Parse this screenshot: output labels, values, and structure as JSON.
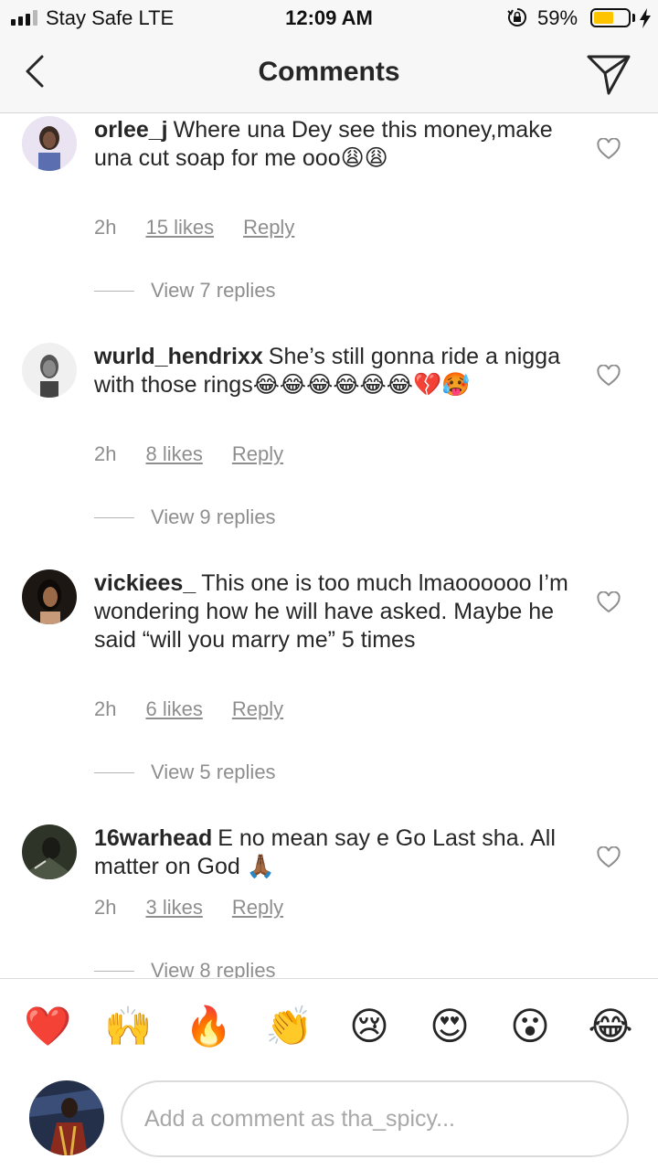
{
  "status_bar": {
    "carrier": "Stay Safe  LTE",
    "time": "12:09 AM",
    "battery": "59%",
    "battery_level": 0.59
  },
  "header": {
    "title": "Comments",
    "back_icon": "chevron-left-icon",
    "send_icon": "paper-plane-icon"
  },
  "comments": [
    {
      "username": "orlee_j",
      "text": "Where una Dey see this money,make una cut soap for me ooo😩😩",
      "time": "2h",
      "likes": "15 likes",
      "reply": "Reply",
      "view_replies": "View 7 replies"
    },
    {
      "username": "wurld_hendrixx",
      "text": "She’s still gonna ride a nigga with those rings😂😂😂😂😂😂💔🥵",
      "time": "2h",
      "likes": "8 likes",
      "reply": "Reply",
      "view_replies": "View 9 replies"
    },
    {
      "username": "vickiees_",
      "text": "This one is too much lmaoooooo I’m wondering how he will have asked. Maybe he said “will you marry me” 5 times",
      "time": "2h",
      "likes": "6 likes",
      "reply": "Reply",
      "view_replies": "View 5 replies"
    },
    {
      "username": "16warhead",
      "text": "E no mean say e Go Last sha. All matter on God 🙏🏾",
      "time": "2h",
      "likes": "3 likes",
      "reply": "Reply",
      "view_replies": "View 8 replies"
    }
  ],
  "emoji_bar": [
    "❤️",
    "🙌",
    "🔥",
    "👏",
    "😢",
    "😍",
    "😮",
    "😂"
  ],
  "composer": {
    "placeholder": "Add a comment as tha_spicy..."
  },
  "colors": {
    "text": "#262626",
    "secondary": "#8e8e8e",
    "battery": "#ffc400"
  }
}
